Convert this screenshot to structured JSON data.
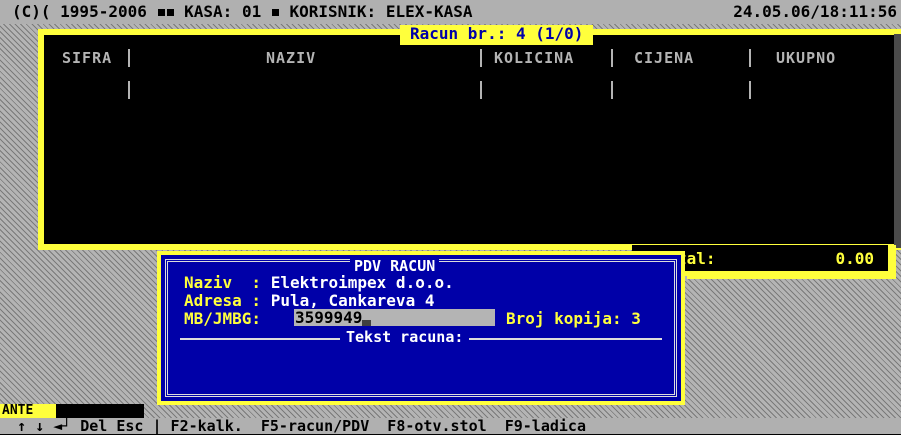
{
  "header": {
    "left_text": "(C)( 1995-2006",
    "kasa_text": "KASA: 01",
    "user_text": "KORISNIK: ELEX-KASA",
    "datetime": "24.05.06/18:11:56"
  },
  "receipt_window": {
    "title": "Racun br.: 4 (1/0)",
    "columns": [
      "SIFRA",
      "NAZIV",
      "KOLICINA",
      "CIJENA",
      "UKUPNO"
    ]
  },
  "total": {
    "label": "tal:",
    "value": "0.00"
  },
  "dialog": {
    "title": "PDV RACUN",
    "naziv_label": "Naziv  : ",
    "naziv_value": "Elektroimpex d.o.o.",
    "adresa_label": "Adresa : ",
    "adresa_value": "Pula, Cankareva 4",
    "mb_label": "MB/JMBG: ",
    "mb_value": "3599949",
    "broj_kopija": "Broj kopija: 3",
    "tekst_label": "Tekst racuna:"
  },
  "user_label": "ANTE",
  "footer": {
    "text": " ↑ ↓ ◄┘ Del Esc | F2-kalk.  F5-racun/PDV  F8-otv.stol  F9-ladica"
  },
  "colors": {
    "accent_yellow": "#ffff3c",
    "dialog_blue": "#0000a8",
    "bar_gray": "#b0b0b0"
  }
}
